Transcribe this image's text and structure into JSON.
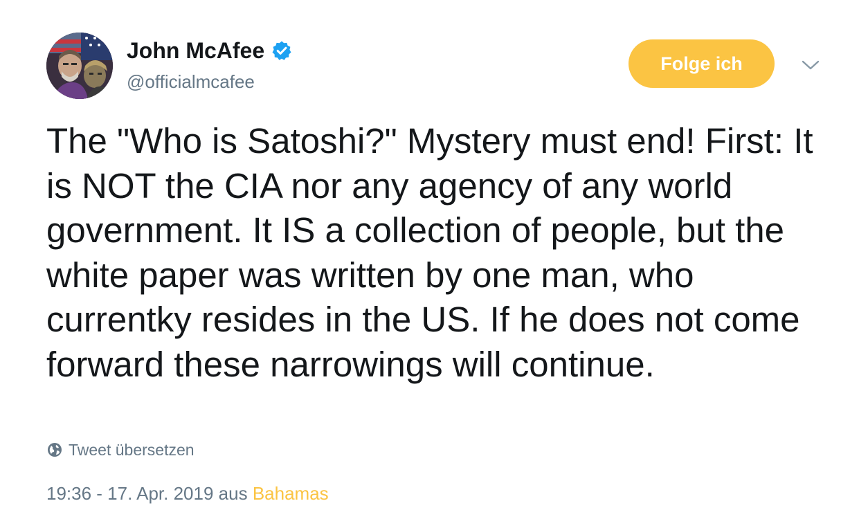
{
  "author": {
    "display_name": "John McAfee",
    "handle": "@officialmcafee",
    "verified": true,
    "avatar_icon": "profile-photo"
  },
  "actions": {
    "follow_label": "Folge ich",
    "more_icon": "chevron-down-icon"
  },
  "tweet": {
    "text": "The \"Who is Satoshi?\" Mystery must end! First: It is NOT the CIA nor any agency of any world government. It IS a collection of people, but the white paper was written by one man, who currentky resides in the US. If he does not come forward these narrowings will continue.",
    "translate_label": "Tweet übersetzen",
    "translate_icon": "globe-icon",
    "timestamp": "19:36 - 17. Apr. 2019",
    "source_prefix": "aus",
    "location": "Bahamas"
  },
  "colors": {
    "accent": "#fbc443",
    "verified_badge": "#1da1f2",
    "secondary_text": "#657786",
    "primary_text": "#14171a"
  }
}
